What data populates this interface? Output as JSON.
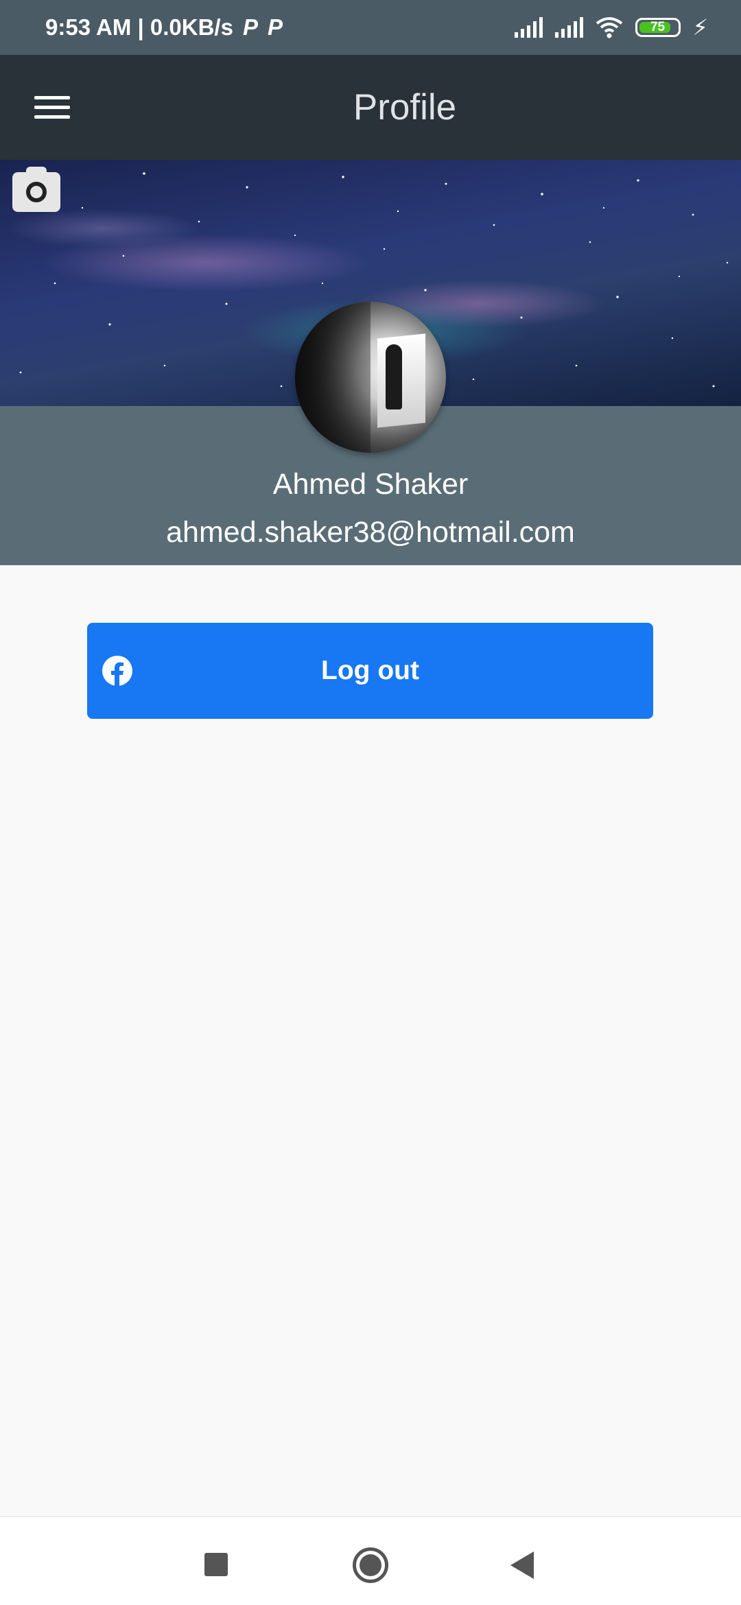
{
  "status_bar": {
    "time_speed": "9:53 AM | 0.0KB/s",
    "notification_icons": [
      "parking-p-icon",
      "parking-p-icon"
    ],
    "battery_level": "75",
    "icons": [
      "signal-icon",
      "signal-icon",
      "wifi-icon",
      "battery-icon",
      "charging-bolt-icon"
    ]
  },
  "app_bar": {
    "title": "Profile",
    "menu_icon": "hamburger-menu-icon"
  },
  "cover": {
    "camera_icon": "camera-icon"
  },
  "profile": {
    "name": "Ahmed Shaker",
    "email": "ahmed.shaker38@hotmail.com"
  },
  "actions": {
    "logout_label": "Log out",
    "logout_icon": "facebook-icon",
    "logout_color": "#1877f2"
  },
  "nav_bar": {
    "icons": [
      "recents-square-icon",
      "home-circle-icon",
      "back-triangle-icon"
    ]
  },
  "colors": {
    "status_bar": "#4b5b65",
    "app_bar": "#283238",
    "profile_band": "#5a6d77",
    "page_background": "#f9f9f9"
  }
}
